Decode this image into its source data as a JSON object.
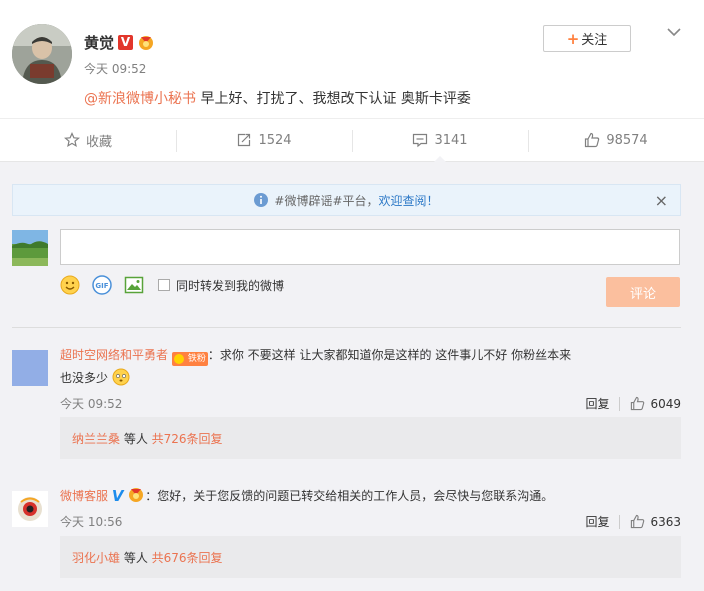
{
  "post": {
    "username": "黄觉",
    "time": "今天 09:52",
    "mention": "@新浪微博小秘书",
    "text": " 早上好、打扰了、我想改下认证  奥斯卡评委",
    "follow_label": "关注",
    "v_badge": "V"
  },
  "actions": {
    "favorite_label": "收藏",
    "repost_count": "1524",
    "comment_count": "3141",
    "like_count": "98574"
  },
  "notice": {
    "text_prefix": "#微博辟谣#平台，",
    "text_link": "欢迎查阅！",
    "close": "×"
  },
  "composer": {
    "input_value": "",
    "forward_label": "同时转发到我的微博",
    "submit_label": "评论"
  },
  "comments": [
    {
      "name": "超时空网络和平勇者",
      "badge": "铁粉",
      "text_line1": "：求你 不要这样 让大家都知道你是这样的 这件事儿不好 你粉丝本来",
      "text_line2": "也没多少",
      "time": "今天 09:52",
      "reply_label": "回复",
      "likes": "6049",
      "reply_user": "纳兰兰桑",
      "reply_mid": " 等人 ",
      "reply_count": "共726条回复"
    },
    {
      "name": "微博客服",
      "verified": "V",
      "text_line1": "：您好，关于您反馈的问题已转交给相关的工作人员，会尽快与您联系沟通。",
      "time": "今天 10:56",
      "reply_label": "回复",
      "likes": "6363",
      "reply_user": "羽化小雄",
      "reply_mid": " 等人 ",
      "reply_count": "共676条回复"
    }
  ],
  "colors": {
    "accent_orange": "#eb7350",
    "link_blue": "#2d79c7",
    "v_red": "#e2362b",
    "v_blue": "#1c8cec",
    "submit_disabled": "#fbbf9e",
    "area_bg": "#f2f2f5"
  }
}
